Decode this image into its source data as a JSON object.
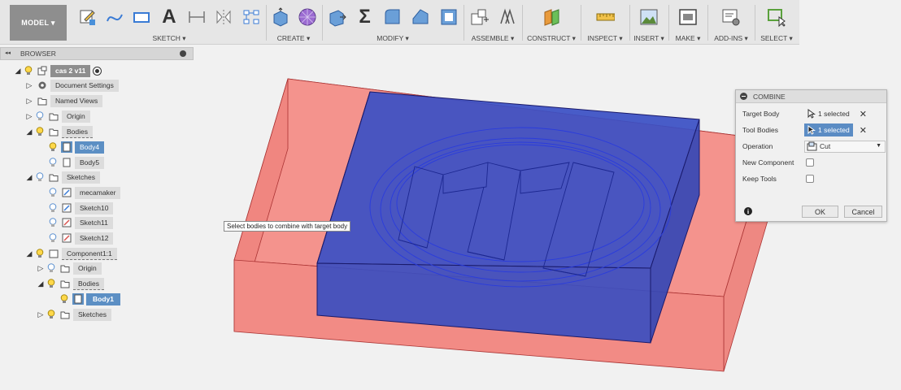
{
  "toolbar": {
    "model": "MODEL ▾",
    "groups": {
      "sketch": "SKETCH ▾",
      "create": "CREATE ▾",
      "modify": "MODIFY ▾",
      "assemble": "ASSEMBLE ▾",
      "construct": "CONSTRUCT ▾",
      "inspect": "INSPECT ▾",
      "insert": "INSERT ▾",
      "make": "MAKE ▾",
      "addins": "ADD-INS ▾",
      "select": "SELECT ▾"
    },
    "sigma": "Σ",
    "text_tool": "A"
  },
  "browser": {
    "title": "BROWSER",
    "collapse": "◂◂",
    "items": [
      {
        "label": "cas 2 v11"
      },
      {
        "label": "Document Settings"
      },
      {
        "label": "Named Views"
      },
      {
        "label": "Origin"
      },
      {
        "label": "Bodies"
      },
      {
        "label": "Body4"
      },
      {
        "label": "Body5"
      },
      {
        "label": "Sketches"
      },
      {
        "label": "mecamaker"
      },
      {
        "label": "Sketch10"
      },
      {
        "label": "Sketch11"
      },
      {
        "label": "Sketch12"
      },
      {
        "label": "Component1:1"
      },
      {
        "label": "Origin"
      },
      {
        "label": "Bodies"
      },
      {
        "label": "Body1"
      },
      {
        "label": "Sketches"
      }
    ]
  },
  "tooltip": "Select bodies to combine with target body",
  "combine": {
    "title": "COMBINE",
    "target_body_label": "Target Body",
    "target_body_value": "1 selected",
    "tool_bodies_label": "Tool Bodies",
    "tool_bodies_value": "1 selected",
    "operation_label": "Operation",
    "operation_value": "Cut",
    "new_component_label": "New Component",
    "keep_tools_label": "Keep Tools",
    "ok": "OK",
    "cancel": "Cancel",
    "info": "i"
  },
  "colors": {
    "target_red": "#f28b85",
    "tool_blue": "#3a4fc4",
    "selection_blue": "#5c8fc4"
  }
}
